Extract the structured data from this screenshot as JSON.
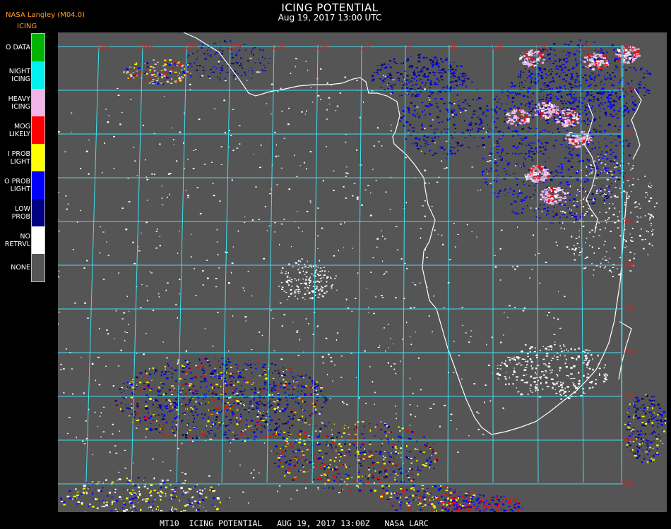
{
  "header": {
    "provider": "NASA Langley (M04.0)",
    "product": "ICING",
    "title": "ICING POTENTIAL",
    "subtitle": "Aug 19, 2017 13:00 UTC"
  },
  "legend": {
    "items": [
      {
        "label": "O DATA",
        "color": "#00b400"
      },
      {
        "label": "NIGHT\nICING",
        "color": "#00f0f0"
      },
      {
        "label": "HEAVY\nICING",
        "color": "#f0b4e6"
      },
      {
        "label": "MOG\nLIKELY",
        "color": "#ff0000"
      },
      {
        "label": "I PROB\nLIGHT",
        "color": "#ffff00"
      },
      {
        "label": "O PROB\nLIGHT",
        "color": "#0000ff"
      },
      {
        "label": "LOW\nPROB",
        "color": "#000082"
      },
      {
        "label": "NO\nRETRVL",
        "color": "#ffffff"
      },
      {
        "label": "NONE",
        "color": "#555555"
      }
    ]
  },
  "map": {
    "background_color": "#555555",
    "grid_color": "#40e0f0",
    "label_color": "#c82828",
    "coastline_color": "#ffffff",
    "top_labels": [
      "35W",
      "30W",
      "25W",
      "20W",
      "15W",
      "10W",
      "5W",
      "0",
      "5E",
      "10E",
      "15E",
      "20E",
      "25E"
    ],
    "right_labels": [
      "10N",
      "5N",
      "0",
      "5S",
      "10S",
      "15S",
      "20S",
      "25S",
      "30S",
      "35S",
      "40S"
    ]
  },
  "footer": {
    "text": "MT10  ICING POTENTIAL   AUG 19, 2017 13:00Z   NASA LARC"
  }
}
